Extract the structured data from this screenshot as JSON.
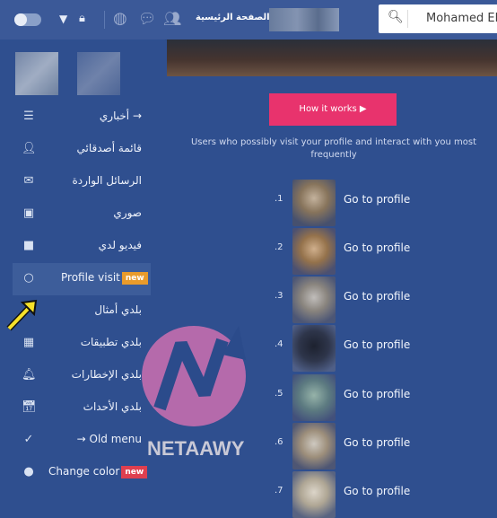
{
  "topbar": {
    "home_label": "الصفحة الرئيسية",
    "search_placeholder": "Mohamed Elg"
  },
  "sidebar": {
    "items": [
      {
        "label": "أخباري →",
        "icon": "menu-icon"
      },
      {
        "label": "قائمة أصدقائي",
        "icon": "friends-icon"
      },
      {
        "label": "الرسائل الواردة",
        "icon": "mail-icon"
      },
      {
        "label": "صوري",
        "icon": "photo-icon"
      },
      {
        "label": "فيديو لدي",
        "icon": "video-icon"
      },
      {
        "label": "Profile visit",
        "badge": "new",
        "icon": "circle-icon"
      },
      {
        "label": "بلدي أمثال",
        "icon": "none"
      },
      {
        "label": "بلدي تطبيقات",
        "icon": "apps-grid-icon"
      },
      {
        "label": "بلدي الإخطارات",
        "icon": "bell-icon"
      },
      {
        "label": "بلدي الأحداث",
        "icon": "calendar-icon"
      },
      {
        "label": "→ Old menu",
        "icon": "check-circle-icon"
      },
      {
        "label": "Change color",
        "badge": "new",
        "icon": "palette-icon"
      }
    ]
  },
  "main": {
    "how_button": "How it works ▶",
    "description": "Users who possibly visit your profile and interact with you most frequently",
    "rows": [
      {
        "num": ".1",
        "link": "Go to profile"
      },
      {
        "num": ".2",
        "link": "Go to profile"
      },
      {
        "num": ".3",
        "link": "Go to profile"
      },
      {
        "num": ".4",
        "link": "Go to profile"
      },
      {
        "num": ".5",
        "link": "Go to profile"
      },
      {
        "num": ".6",
        "link": "Go to profile"
      },
      {
        "num": ".7",
        "link": "Go to profile"
      }
    ]
  },
  "watermark": {
    "text": "NETAAWY"
  },
  "colors": {
    "header": "#3b5998",
    "accent": "#e8336d",
    "badge_new_orange": "#e99b2b",
    "badge_new_red": "#df3f4f"
  }
}
